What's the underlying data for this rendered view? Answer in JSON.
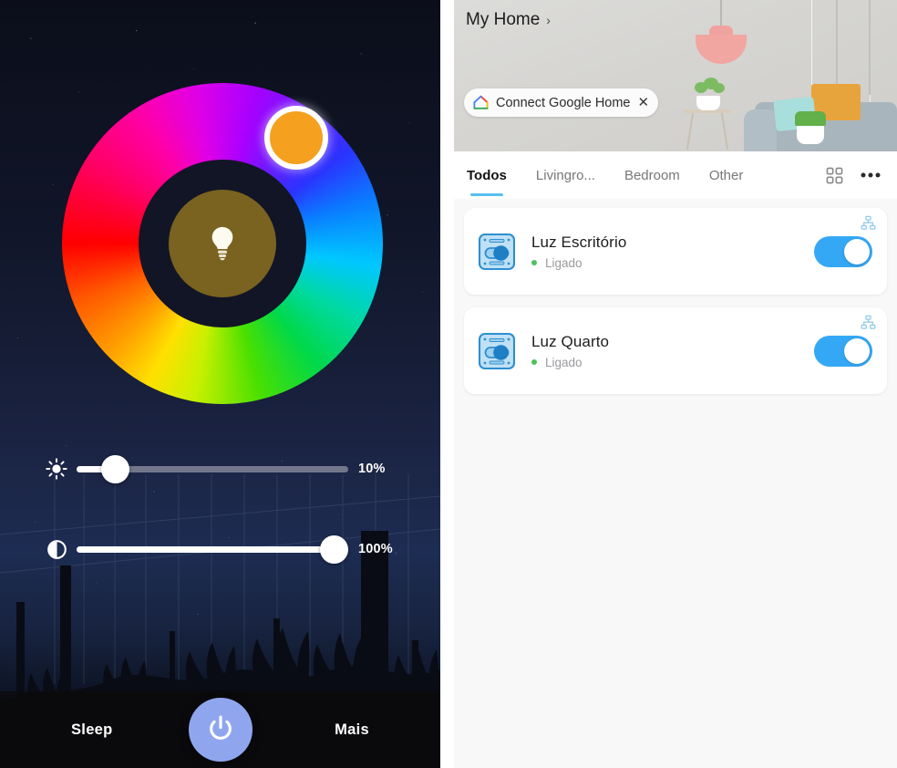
{
  "left_panel": {
    "color_wheel": {
      "name": "color-wheel",
      "selected_color": "#F5A01E",
      "handle_angle_deg": 55,
      "center_color": "#7A6220",
      "bulb_icon": "bulb-icon"
    },
    "sliders": [
      {
        "name": "brightness",
        "icon": "brightness-sun-icon",
        "value": 10,
        "value_label": "10%"
      },
      {
        "name": "saturation",
        "icon": "contrast-half-circle-icon",
        "value": 100,
        "value_label": "100%"
      }
    ],
    "bottom_bar": {
      "sleep_label": "Sleep",
      "more_label": "Mais",
      "power_icon": "power-icon",
      "power_color": "#8FA6EF"
    }
  },
  "right_panel": {
    "header": {
      "home_title": "My Home",
      "chevron": "›",
      "chip": {
        "icon": "google-home-icon",
        "label": "Connect Google Home",
        "close_icon": "close-icon",
        "close_glyph": "✕"
      }
    },
    "tabs": {
      "items": [
        {
          "label": "Todos",
          "active": true
        },
        {
          "label": "Livingro...",
          "active": false
        },
        {
          "label": "Bedroom",
          "active": false
        },
        {
          "label": "Other",
          "active": false
        }
      ],
      "grid_icon": "grid-view-icon",
      "more_icon": "more-horizontal-icon",
      "underline_color": "#58C0F0"
    },
    "devices": [
      {
        "name": "Luz Escritório",
        "status": "Ligado",
        "status_color": "#4CC25E",
        "toggle_on": true,
        "toggle_color": "#35A8F5",
        "device_icon": "smart-switch-icon",
        "network_icon": "network-topology-icon"
      },
      {
        "name": "Luz Quarto",
        "status": "Ligado",
        "status_color": "#4CC25E",
        "toggle_on": true,
        "toggle_color": "#35A8F5",
        "device_icon": "smart-switch-icon",
        "network_icon": "network-topology-icon"
      }
    ]
  }
}
